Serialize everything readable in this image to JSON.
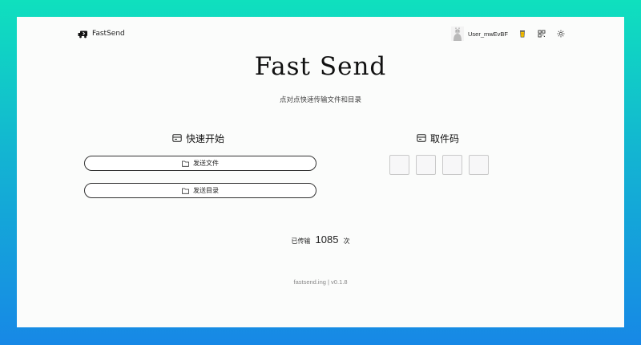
{
  "header": {
    "brand": "FastSend",
    "username": "User_mwEvBF",
    "icons": [
      "cup-icon",
      "qr-icon",
      "theme-sun-icon"
    ]
  },
  "hero": {
    "title": "Fast Send",
    "subtitle": "点对点快速传输文件和目录"
  },
  "quick_start": {
    "heading": "快速开始",
    "send_file_label": "发送文件",
    "send_dir_label": "发送目录"
  },
  "pickup": {
    "heading": "取件码",
    "code_values": [
      "",
      "",
      "",
      ""
    ]
  },
  "stats": {
    "prefix": "已传输",
    "count": "1085",
    "suffix": "次"
  },
  "footer": {
    "text": "fastsend.ing | v0.1.8"
  },
  "colors": {
    "gradient_top": "#0fe0be",
    "gradient_bottom": "#1788e6",
    "panel": "#fbfcfb"
  }
}
